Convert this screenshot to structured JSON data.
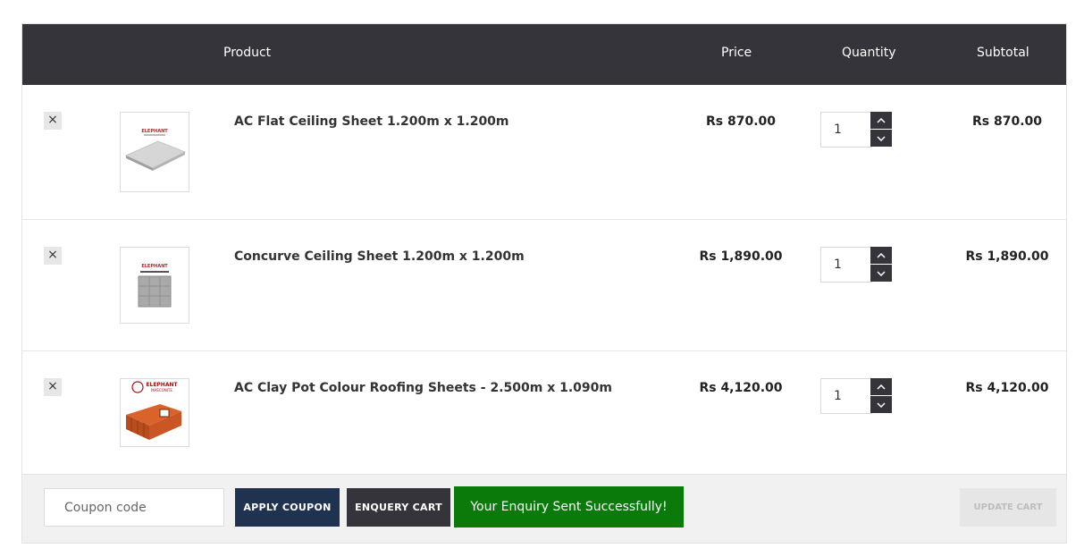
{
  "header": {
    "product": "Product",
    "price": "Price",
    "quantity": "Quantity",
    "subtotal": "Subtotal"
  },
  "items": [
    {
      "remove": "×",
      "name": "AC Flat Ceiling Sheet 1.200m x 1.200m",
      "price": "Rs 870.00",
      "quantity": "1",
      "subtotal": "Rs 870.00"
    },
    {
      "remove": "×",
      "name": "Concurve Ceiling Sheet 1.200m x 1.200m",
      "price": "Rs 1,890.00",
      "quantity": "1",
      "subtotal": "Rs 1,890.00"
    },
    {
      "remove": "×",
      "name": "AC Clay Pot Colour Roofing Sheets - 2.500m x 1.090m",
      "price": "Rs 4,120.00",
      "quantity": "1",
      "subtotal": "Rs 4,120.00"
    }
  ],
  "actions": {
    "coupon_placeholder": "Coupon code",
    "apply_label": "APPLY COUPON",
    "enquiry_label": "ENQUERY CART",
    "success_message": "Your Enquiry Sent Successfully!",
    "update_label": "UPDATE CART"
  },
  "colors": {
    "header_bg": "#34343a",
    "apply_bg": "#1f3350",
    "success_bg": "#0a7a0a"
  }
}
